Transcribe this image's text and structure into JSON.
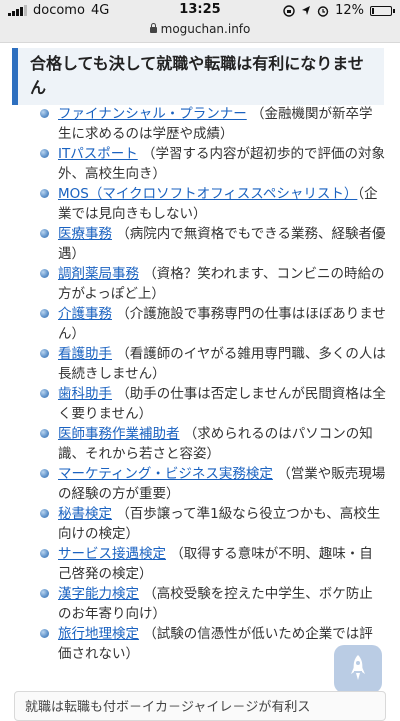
{
  "status_bar": {
    "carrier": "docomo",
    "network": "4G",
    "time": "13:25",
    "battery": "12%",
    "battery_level": 0.12
  },
  "browser": {
    "url": "moguchan.info"
  },
  "section": {
    "heading": "合格しても決して就職や転職は有利になりません"
  },
  "items": [
    {
      "title": "ファイナンシャル・プランナー",
      "desc": "（金融機関が新卒学生に求めるのは学歴や成績）"
    },
    {
      "title": "ITパスポート",
      "desc": "（学習する内容が超初歩的で評価の対象外、高校生向き）"
    },
    {
      "title": "MOS（マイクロソフトオフィススペシャリスト）",
      "desc": "（企業では見向きもしない）"
    },
    {
      "title": "医療事務",
      "desc": "（病院内で無資格でもできる業務、経験者優遇）"
    },
    {
      "title": "調剤薬局事務",
      "desc": "（資格？笑われます、コンビニの時給の方がよっぽど上）"
    },
    {
      "title": "介護事務",
      "desc": "（介護施設で事務専門の仕事はほぼありません）"
    },
    {
      "title": "看護助手",
      "desc": "（看護師のイヤがる雑用専門職、多くの人は長続きしません）"
    },
    {
      "title": "歯科助手",
      "desc": "（助手の仕事は否定しませんが民間資格は全く要りません）"
    },
    {
      "title": "医師事務作業補助者",
      "desc": "（求められるのはパソコンの知識、それから若さと容姿）"
    },
    {
      "title": "マーケティング・ビジネス実務検定",
      "desc": "（営業や販売現場の経験の方が重要）"
    },
    {
      "title": "秘書検定",
      "desc": "（百歩譲って準1級なら役立つかも、高校生向けの検定）"
    },
    {
      "title": "サービス接遇検定",
      "desc": "（取得する意味が不明、趣味・自己啓発の検定）"
    },
    {
      "title": "漢字能力検定",
      "desc": "（高校受験を控えた中学生、ボケ防止のお年寄り向け）"
    },
    {
      "title": "旅行地理検定",
      "desc": "（試験の信憑性が低いため企業では評価されない）"
    }
  ],
  "bottom_box": {
    "text": "就職は転職も付ボ－イカ－ジャイレ－ジが有利ス"
  },
  "icons": {
    "back_to_top": "rocket-icon",
    "lock": "lock-icon"
  },
  "colors": {
    "accent": "#2d6fbf",
    "link": "#1a62c0",
    "heading_bg": "#eef3f8"
  }
}
